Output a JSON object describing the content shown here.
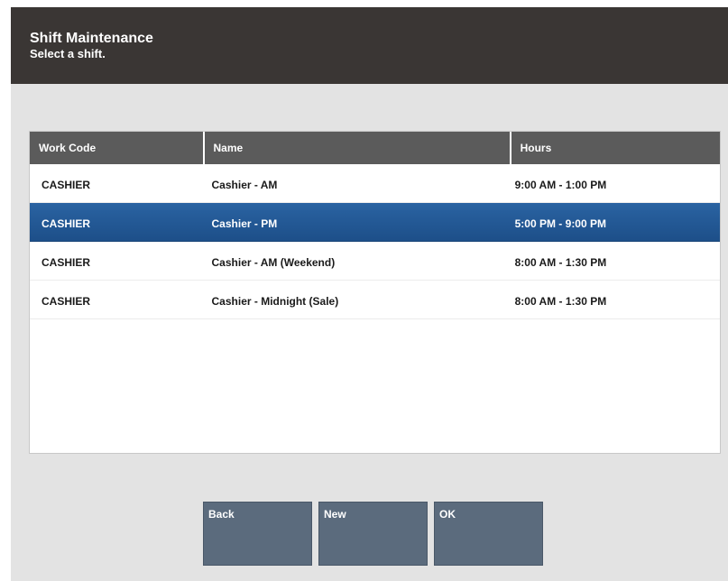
{
  "header": {
    "title": "Shift Maintenance",
    "subtitle": "Select a shift."
  },
  "table": {
    "columns": [
      "Work Code",
      "Name",
      "Hours"
    ],
    "rows": [
      {
        "work_code": "CASHIER",
        "name": "Cashier - AM",
        "hours": "9:00 AM - 1:00 PM",
        "selected": false
      },
      {
        "work_code": "CASHIER",
        "name": "Cashier - PM",
        "hours": "5:00 PM - 9:00 PM",
        "selected": true
      },
      {
        "work_code": "CASHIER",
        "name": "Cashier - AM (Weekend)",
        "hours": "8:00 AM - 1:30 PM",
        "selected": false
      },
      {
        "work_code": "CASHIER",
        "name": "Cashier - Midnight (Sale)",
        "hours": "8:00 AM - 1:30 PM",
        "selected": false
      }
    ]
  },
  "buttons": {
    "back": "Back",
    "new": "New",
    "ok": "OK"
  },
  "colors": {
    "header_bg": "#3a3634",
    "body_bg": "#e3e3e3",
    "table_header_bg": "#5b5b5b",
    "selected_row_bg": "#2a63a2",
    "button_bg": "#5b6b7d"
  }
}
